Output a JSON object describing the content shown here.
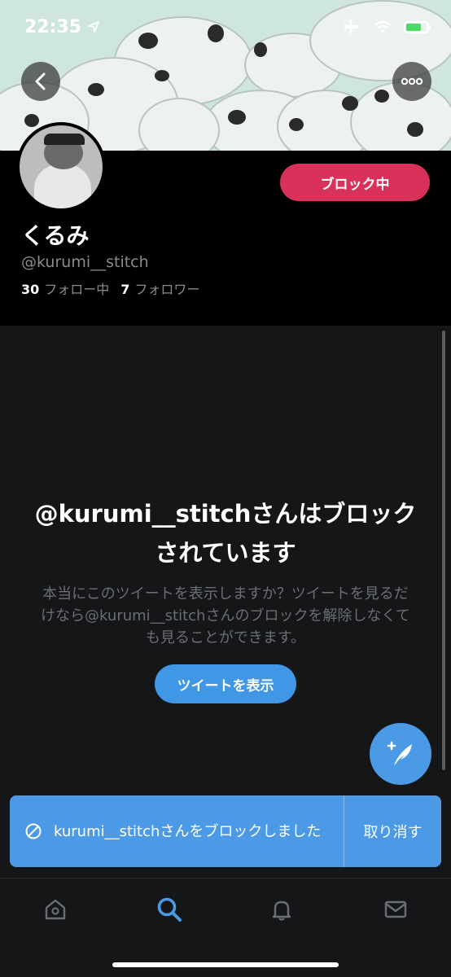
{
  "status_bar": {
    "time": "22:35"
  },
  "profile": {
    "display_name": "くるみ",
    "handle": "@kurumi__stitch",
    "following_count": "30",
    "following_label": "フォロー中",
    "followers_count": "7",
    "followers_label": "フォロワー",
    "block_button_label": "ブロック中"
  },
  "blocked": {
    "title": "@kurumi__stitchさんはブロックされています",
    "description": "本当にこのツイートを表示しますか？ツイートを見るだけなら@kurumi__stitchさんのブロックを解除しなくても見ることができます。",
    "show_button_label": "ツイートを表示"
  },
  "snackbar": {
    "message": "kurumi__stitchさんをブロックしました",
    "undo_label": "取り消す"
  },
  "tabs": [
    {
      "icon": "home-icon"
    },
    {
      "icon": "search-icon",
      "active": true
    },
    {
      "icon": "bell-icon"
    },
    {
      "icon": "mail-icon"
    }
  ],
  "colors": {
    "accent": "#4a9ae6",
    "block": "#d8325a",
    "background": "#151618"
  }
}
